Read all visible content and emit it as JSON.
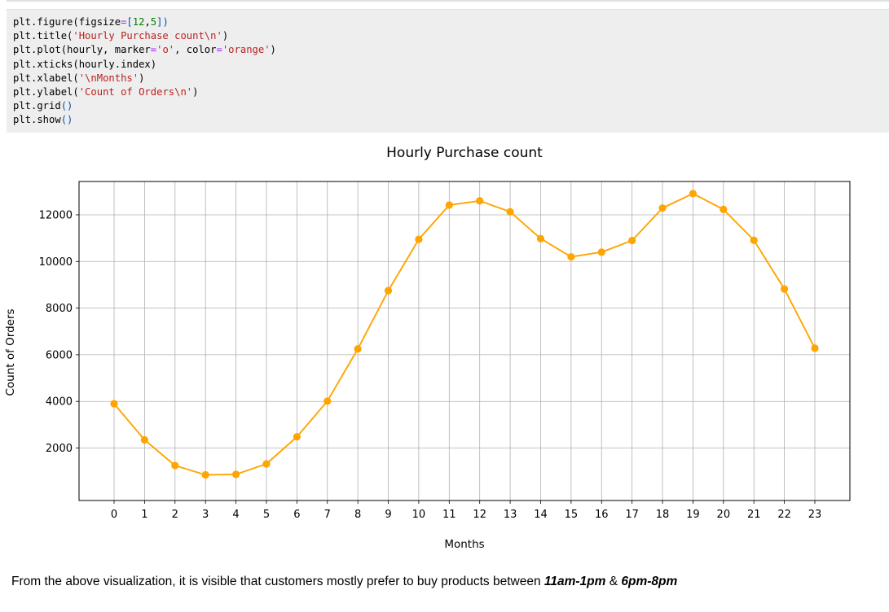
{
  "code_cell": {
    "lines": [
      [
        {
          "t": "plt.figure(figsize",
          "c": ""
        },
        {
          "t": "=",
          "c": "op"
        },
        {
          "t": "[",
          "c": "br"
        },
        {
          "t": "12",
          "c": "num"
        },
        {
          "t": ",",
          "c": ""
        },
        {
          "t": "5",
          "c": "num"
        },
        {
          "t": "])",
          "c": "br"
        }
      ],
      [
        {
          "t": "plt.title(",
          "c": ""
        },
        {
          "t": "'Hourly Purchase count\\n'",
          "c": "str"
        },
        {
          "t": ")",
          "c": ""
        }
      ],
      [
        {
          "t": "plt.plot(hourly, marker",
          "c": ""
        },
        {
          "t": "=",
          "c": "op"
        },
        {
          "t": "'o'",
          "c": "str"
        },
        {
          "t": ", color",
          "c": ""
        },
        {
          "t": "=",
          "c": "op"
        },
        {
          "t": "'orange'",
          "c": "str"
        },
        {
          "t": ")",
          "c": ""
        }
      ],
      [
        {
          "t": "plt.xticks(hourly.index)",
          "c": ""
        }
      ],
      [
        {
          "t": "plt.xlabel(",
          "c": ""
        },
        {
          "t": "'\\nMonths'",
          "c": "str"
        },
        {
          "t": ")",
          "c": ""
        }
      ],
      [
        {
          "t": "plt.ylabel(",
          "c": ""
        },
        {
          "t": "'Count of Orders\\n'",
          "c": "str"
        },
        {
          "t": ")",
          "c": ""
        }
      ],
      [
        {
          "t": "plt.grid",
          "c": ""
        },
        {
          "t": "()",
          "c": "br"
        }
      ],
      [
        {
          "t": "plt.show",
          "c": ""
        },
        {
          "t": "()",
          "c": "br"
        }
      ]
    ]
  },
  "chart_data": {
    "type": "line",
    "title": "Hourly Purchase count",
    "xlabel": "Months",
    "ylabel": "Count of Orders",
    "x": [
      0,
      1,
      2,
      3,
      4,
      5,
      6,
      7,
      8,
      9,
      10,
      11,
      12,
      13,
      14,
      15,
      16,
      17,
      18,
      19,
      20,
      21,
      22,
      23
    ],
    "series": [
      {
        "values": [
          3900,
          2350,
          1250,
          850,
          870,
          1320,
          2480,
          4010,
          6250,
          8750,
          10950,
          12420,
          12600,
          12130,
          10980,
          10200,
          10400,
          10900,
          12290,
          12910,
          12230,
          10910,
          8820,
          6280
        ]
      }
    ],
    "xlim": [
      -1.15,
      24.15
    ],
    "ylim": [
      -250,
      13430
    ],
    "yticks": [
      2000,
      4000,
      6000,
      8000,
      10000,
      12000
    ],
    "grid": true,
    "marker": "o",
    "color": "#ffa500"
  },
  "conclusion": {
    "prefix": "From the above visualization, it is visible that customers mostly prefer to buy products between ",
    "range1": "11am-1pm",
    "joiner": " & ",
    "range2": "6pm-8pm"
  }
}
